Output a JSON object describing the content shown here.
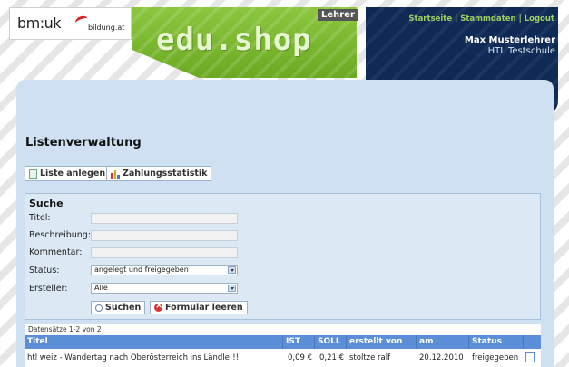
{
  "header": {
    "logo_bmuk": "bm:uk",
    "logo_bildung": "bildung.at",
    "shop_title": "edu.shop",
    "role": "Lehrer",
    "links": [
      "Startseite",
      "Stammdaten",
      "Logout"
    ],
    "user_name": "Max Musterlehrer",
    "school": "HTL Testschule"
  },
  "page": {
    "title": "Listenverwaltung",
    "buttons": {
      "create_list": "Liste anlegen",
      "payment_stats": "Zahlungsstatistik"
    }
  },
  "search": {
    "title": "Suche",
    "fields": {
      "title_label": "Titel:",
      "title_value": "",
      "description_label": "Beschreibung:",
      "description_value": "",
      "comment_label": "Kommentar:",
      "comment_value": "",
      "status_label": "Status:",
      "status_value": "angelegt und freigegeben",
      "creator_label": "Ersteller:",
      "creator_value": "Alle"
    },
    "search_button": "Suchen",
    "clear_button": "Formular leeren"
  },
  "results": {
    "count_text": "Datensätze 1-2 von 2",
    "columns": [
      "Titel",
      "IST",
      "SOLL",
      "erstellt von",
      "am",
      "Status"
    ],
    "rows": [
      {
        "title": "htl weiz - Wandertag nach Oberösterreich ins Ländle!!!",
        "ist": "0,09 €",
        "soll": "0,21 €",
        "created_by": "stoltze ralf",
        "date": "20.12.2010",
        "status": "freigegeben"
      }
    ]
  }
}
